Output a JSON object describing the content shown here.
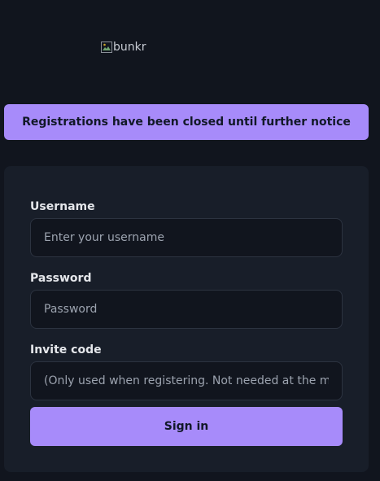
{
  "logo": {
    "alt_text": "bunkr",
    "icon": "broken-image-icon"
  },
  "notice": {
    "text": "Registrations have been closed until further notice"
  },
  "form": {
    "username": {
      "label": "Username",
      "placeholder": "Enter your username",
      "value": ""
    },
    "password": {
      "label": "Password",
      "placeholder": "Password",
      "value": ""
    },
    "invite": {
      "label": "Invite code",
      "placeholder": "(Only used when registering. Not needed at the mom",
      "value": ""
    },
    "submit_label": "Sign in"
  },
  "colors": {
    "background": "#11151e",
    "card": "#181e29",
    "accent": "#a78bfa",
    "input_border": "#2c3340"
  }
}
